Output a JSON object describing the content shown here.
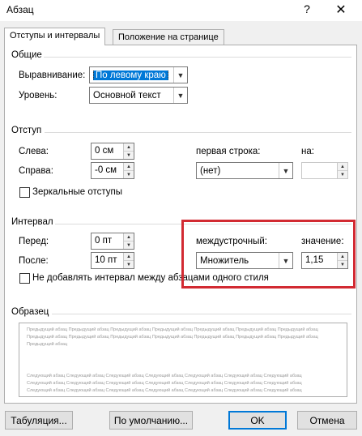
{
  "window": {
    "title": "Абзац",
    "help_glyph": "?",
    "close_glyph": "✕"
  },
  "tabs": [
    {
      "label": "Отступы и интервалы",
      "active": true
    },
    {
      "label": "Положение на странице",
      "active": false
    }
  ],
  "general": {
    "title": "Общие",
    "alignment_label": "Выравнивание:",
    "alignment_value": "По левому краю",
    "level_label": "Уровень:",
    "level_value": "Основной текст"
  },
  "indent": {
    "title": "Отступ",
    "left_label": "Слева:",
    "left_value": "0 см",
    "right_label": "Справа:",
    "right_value": "-0 см",
    "first_line_label": "первая строка:",
    "first_line_value": "(нет)",
    "by_label": "на:",
    "by_value": "",
    "mirror_label": "Зеркальные отступы"
  },
  "spacing": {
    "title": "Интервал",
    "before_label": "Перед:",
    "before_value": "0 пт",
    "after_label": "После:",
    "after_value": "10 пт",
    "line_spacing_label": "междустрочный:",
    "line_spacing_value": "Множитель",
    "at_label": "значение:",
    "at_value": "1,15",
    "no_space_label": "Не добавлять интервал между абзацами одного стиля"
  },
  "preview": {
    "title": "Образец",
    "prev_lines": [
      "Предыдущий абзац Предыдущий абзац Предыдущий абзац Предыдущий абзац Предыдущий абзац Предыдущий абзац Предыдущий абзац",
      "Предыдущий абзац Предыдущий абзац Предыдущий абзац Предыдущий абзац Предыдущий абзац Предыдущий абзац Предыдущий абзац",
      "Предыдущий абзац"
    ],
    "next_lines": [
      "Следующий абзац Следующий абзац Следующий абзац Следующий абзац Следующий абзац Следующий абзац Следующий абзац",
      "Следующий абзац Следующий абзац Следующий абзац Следующий абзац Следующий абзац Следующий абзац Следующий абзац",
      "Следующий абзац Следующий абзац Следующий абзац Следующий абзац Следующий абзац Следующий абзац Следующий абзац"
    ]
  },
  "buttons": {
    "tabs": "Табуляция...",
    "default": "По умолчанию...",
    "ok": "OK",
    "cancel": "Отмена"
  },
  "colors": {
    "highlight_box": "#d22a32",
    "selection": "#0078d7"
  }
}
